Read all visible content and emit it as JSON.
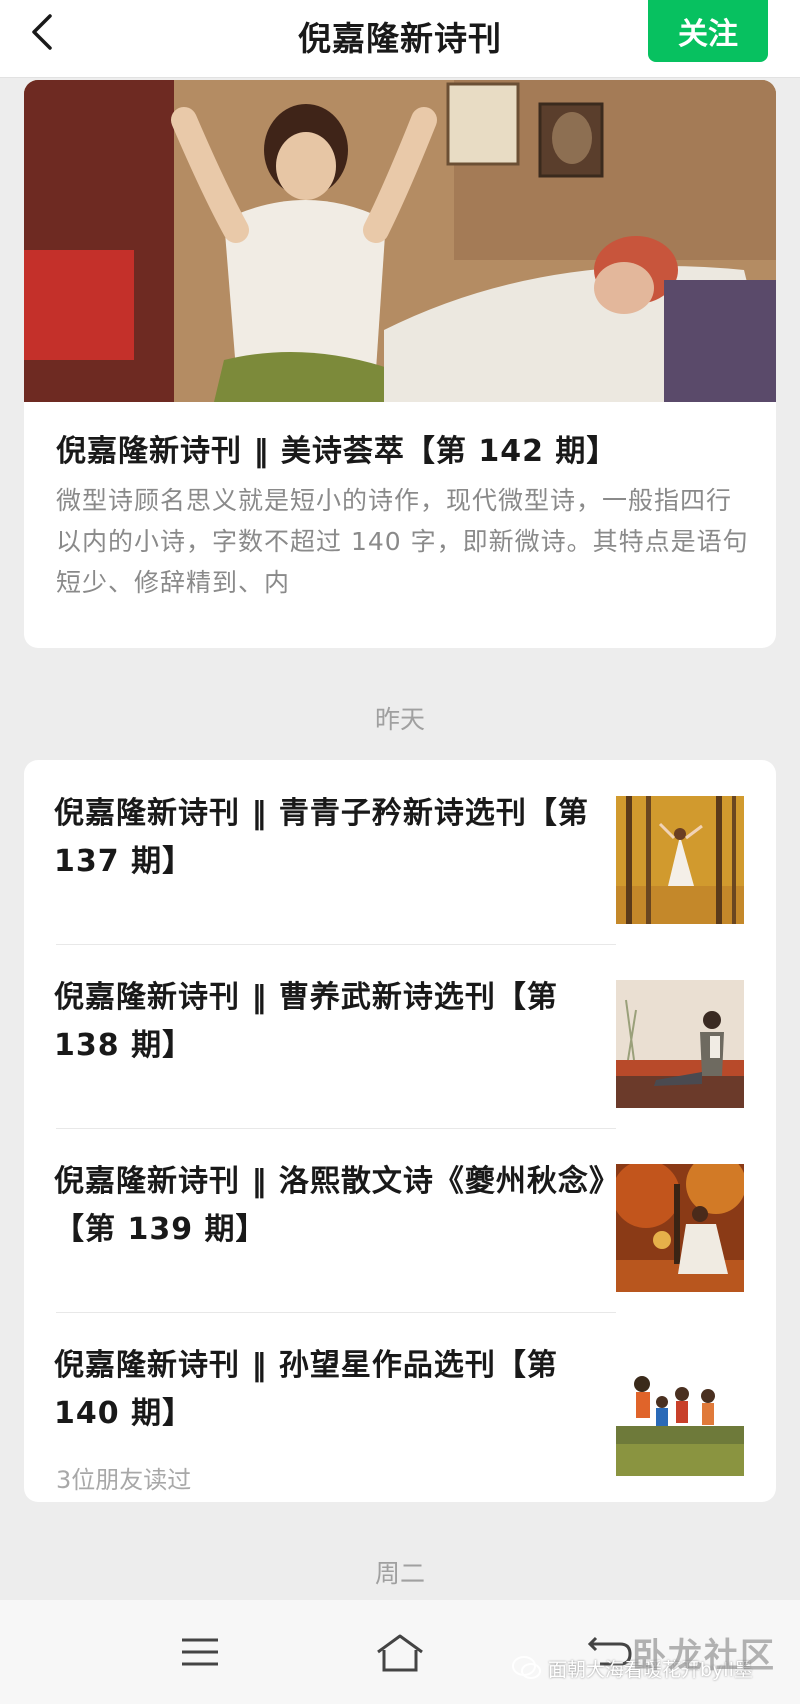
{
  "header": {
    "title": "倪嘉隆新诗刊",
    "follow_label": "关注"
  },
  "featured": {
    "title": "倪嘉隆新诗刊 ‖ 美诗荟萃【第 142 期】",
    "description": "微型诗顾名思义就是短小的诗作，现代微型诗，一般指四行以内的小诗，字数不超过 140 字，即新微诗。其特点是语句短少、修辞精到、内"
  },
  "sections": [
    {
      "label": "昨天"
    },
    {
      "label": "周二"
    }
  ],
  "articles": [
    {
      "title": "倪嘉隆新诗刊 ‖ 青青子矜新诗选刊【第 137 期】",
      "subtitle": ""
    },
    {
      "title": "倪嘉隆新诗刊 ‖ 曹养武新诗选刊【第 138 期】",
      "subtitle": ""
    },
    {
      "title": "倪嘉隆新诗刊 ‖ 洛熙散文诗《夔州秋念》【第 139 期】",
      "subtitle": ""
    },
    {
      "title": "倪嘉隆新诗刊 ‖ 孙望星作品选刊【第 140 期】",
      "subtitle": "3位朋友读过"
    }
  ],
  "watermark": {
    "text": "面朝大海看暖花开byll墨",
    "logo": "卧龙社区"
  },
  "colors": {
    "accent": "#07c160",
    "background": "#ededed",
    "secondary_text": "#8a8a8a"
  }
}
